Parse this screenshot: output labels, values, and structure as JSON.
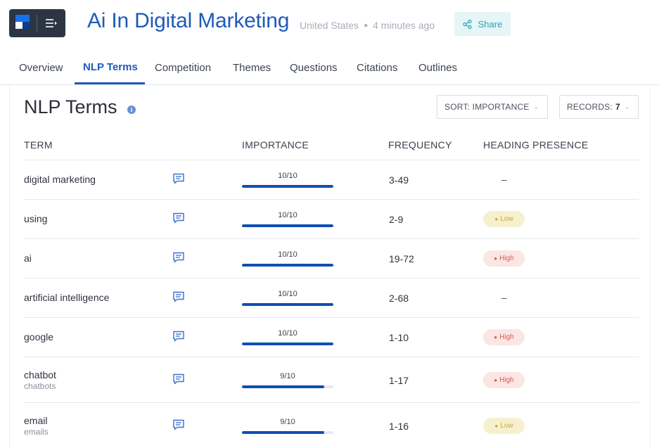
{
  "header": {
    "title": "Ai In Digital Marketing",
    "country": "United States",
    "updated": "4 minutes ago",
    "share_label": "Share"
  },
  "tabs": [
    "Overview",
    "NLP Terms",
    "Competition",
    "Themes",
    "Questions",
    "Citations",
    "Outlines"
  ],
  "active_tab": "NLP Terms",
  "panel": {
    "title": "NLP Terms",
    "sort_label": "SORT: IMPORTANCE",
    "records_label": "RECORDS:",
    "records_value": "7"
  },
  "table": {
    "columns": [
      "TERM",
      "IMPORTANCE",
      "FREQUENCY",
      "HEADING PRESENCE"
    ],
    "rows": [
      {
        "term": "digital marketing",
        "variant": "",
        "importance": "10/10",
        "importance_level": 1.0,
        "frequency": "3-49",
        "heading": "–",
        "heading_type": "none"
      },
      {
        "term": "using",
        "variant": "",
        "importance": "10/10",
        "importance_level": 1.0,
        "frequency": "2-9",
        "heading": "Low",
        "heading_type": "low"
      },
      {
        "term": "ai",
        "variant": "",
        "importance": "10/10",
        "importance_level": 1.0,
        "frequency": "19-72",
        "heading": "High",
        "heading_type": "high"
      },
      {
        "term": "artificial intelligence",
        "variant": "",
        "importance": "10/10",
        "importance_level": 1.0,
        "frequency": "2-68",
        "heading": "–",
        "heading_type": "none"
      },
      {
        "term": "google",
        "variant": "",
        "importance": "10/10",
        "importance_level": 1.0,
        "frequency": "1-10",
        "heading": "High",
        "heading_type": "high"
      },
      {
        "term": "chatbot",
        "variant": "chatbots",
        "importance": "9/10",
        "importance_level": 0.9,
        "frequency": "1-17",
        "heading": "High",
        "heading_type": "high"
      },
      {
        "term": "email",
        "variant": "emails",
        "importance": "9/10",
        "importance_level": 0.9,
        "frequency": "1-16",
        "heading": "Low",
        "heading_type": "low"
      }
    ]
  },
  "colors": {
    "accent": "#1f5bb8",
    "bar_fill": "#0f4fb3",
    "share_text": "#2aa6b4",
    "badge_low": "#c9a53a",
    "badge_high": "#d9594e"
  }
}
